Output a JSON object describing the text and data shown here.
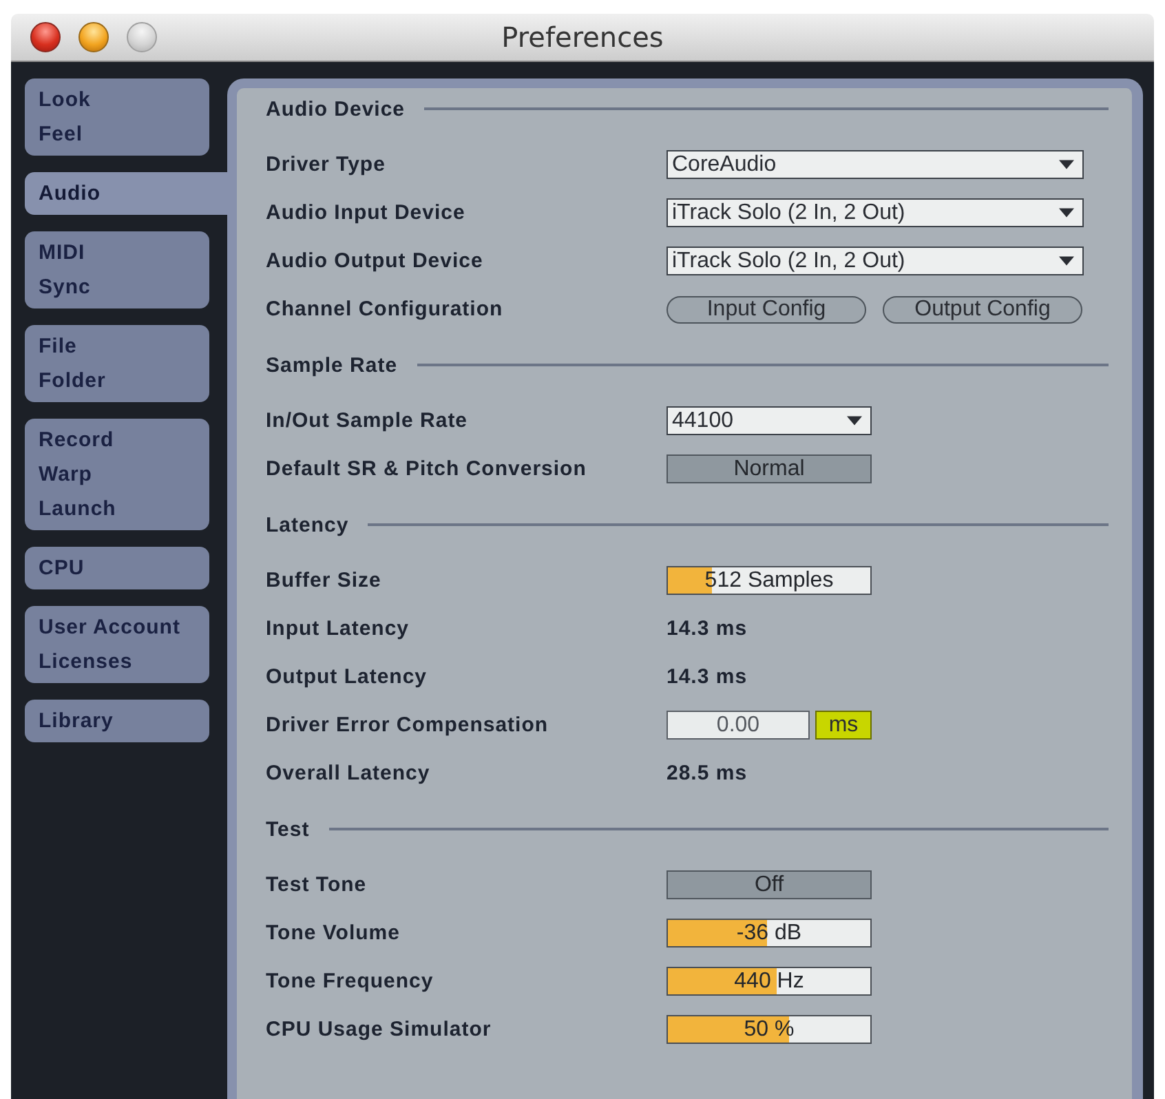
{
  "window": {
    "title": "Preferences",
    "controls": [
      {
        "kind": "close",
        "disabled": false
      },
      {
        "kind": "minimize",
        "disabled": false
      },
      {
        "kind": "zoom",
        "disabled": true
      }
    ]
  },
  "tabs": [
    {
      "lines": [
        "Look",
        "Feel"
      ],
      "selected": false
    },
    {
      "lines": [
        "Audio"
      ],
      "selected": true
    },
    {
      "lines": [
        "MIDI",
        "Sync"
      ],
      "selected": false
    },
    {
      "lines": [
        "File",
        "Folder"
      ],
      "selected": false
    },
    {
      "lines": [
        "Record",
        "Warp",
        "Launch"
      ],
      "selected": false
    },
    {
      "lines": [
        "CPU"
      ],
      "selected": false
    },
    {
      "lines": [
        "User Account",
        "Licenses"
      ],
      "selected": false
    },
    {
      "lines": [
        "Library"
      ],
      "selected": false
    }
  ],
  "sections": [
    {
      "title": "Audio Device",
      "rows": [
        {
          "kind": "dropdown",
          "label": "Driver Type",
          "value": "CoreAudio"
        },
        {
          "kind": "dropdown",
          "label": "Audio Input Device",
          "value": "iTrack Solo (2 In, 2 Out)"
        },
        {
          "kind": "dropdown",
          "label": "Audio Output Device",
          "value": "iTrack Solo (2 In, 2 Out)"
        },
        {
          "kind": "buttons",
          "label": "Channel Configuration",
          "buttons": [
            "Input Config",
            "Output Config"
          ]
        }
      ]
    },
    {
      "title": "Sample Rate",
      "rows": [
        {
          "kind": "dropdown",
          "label": "In/Out Sample Rate",
          "value": "44100"
        },
        {
          "kind": "button",
          "label": "Default SR & Pitch Conversion",
          "value": "Normal"
        }
      ]
    },
    {
      "title": "Latency",
      "rows": [
        {
          "kind": "slider",
          "label": "Buffer Size",
          "value": "512 Samples",
          "level": 0.22
        },
        {
          "kind": "readout",
          "label": "Input Latency",
          "value": "14.3 ms"
        },
        {
          "kind": "readout",
          "label": "Output Latency",
          "value": "14.3 ms"
        },
        {
          "kind": "number",
          "label": "Driver Error Compensation",
          "value": "0.00",
          "unit": "ms"
        },
        {
          "kind": "readout",
          "label": "Overall Latency",
          "value": "28.5 ms"
        }
      ]
    },
    {
      "title": "Test",
      "rows": [
        {
          "kind": "button",
          "label": "Test Tone",
          "value": "Off"
        },
        {
          "kind": "slider",
          "label": "Tone Volume",
          "value": "-36 dB",
          "level": 0.49
        },
        {
          "kind": "slider",
          "label": "Tone Frequency",
          "value": "440 Hz",
          "level": 0.54
        },
        {
          "kind": "slider",
          "label": "CPU Usage Simulator",
          "value": "50 %",
          "level": 0.6
        }
      ]
    }
  ]
}
